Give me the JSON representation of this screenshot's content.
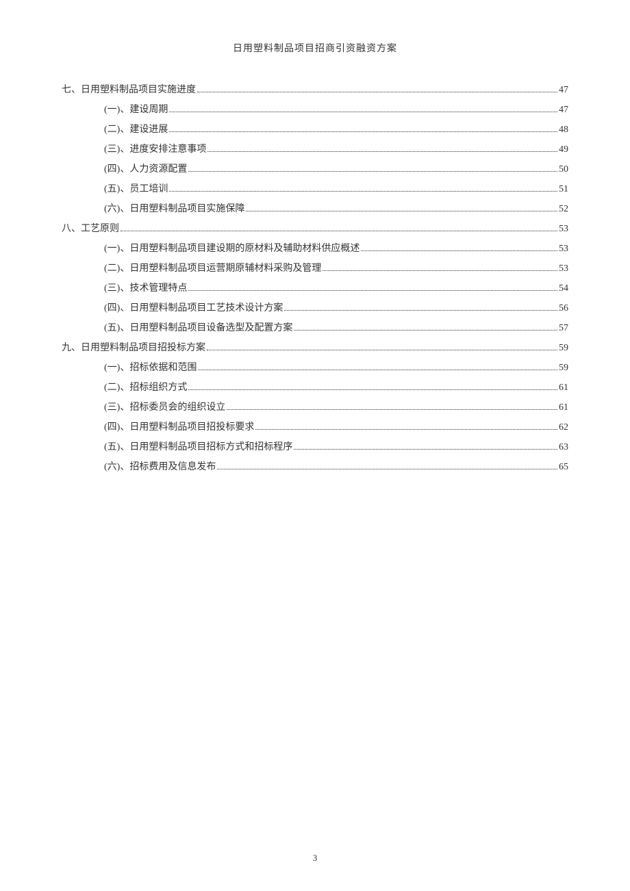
{
  "header": {
    "title": "日用塑料制品项目招商引资融资方案"
  },
  "toc": [
    {
      "level": 1,
      "label": "七、日用塑料制品项目实施进度",
      "page": "47"
    },
    {
      "level": 2,
      "label": "(一)、建设周期",
      "page": "47"
    },
    {
      "level": 2,
      "label": "(二)、建设进展",
      "page": "48"
    },
    {
      "level": 2,
      "label": "(三)、进度安排注意事项",
      "page": "49"
    },
    {
      "level": 2,
      "label": "(四)、人力资源配置",
      "page": "50"
    },
    {
      "level": 2,
      "label": "(五)、员工培训",
      "page": "51"
    },
    {
      "level": 2,
      "label": "(六)、日用塑料制品项目实施保障",
      "page": "52"
    },
    {
      "level": 1,
      "label": "八、工艺原则",
      "page": "53"
    },
    {
      "level": 2,
      "label": "(一)、日用塑料制品项目建设期的原材料及辅助材料供应概述",
      "page": "53"
    },
    {
      "level": 2,
      "label": "(二)、日用塑料制品项目运营期原辅材料采购及管理",
      "page": "53"
    },
    {
      "level": 2,
      "label": "(三)、技术管理特点",
      "page": "54"
    },
    {
      "level": 2,
      "label": "(四)、日用塑料制品项目工艺技术设计方案",
      "page": "56"
    },
    {
      "level": 2,
      "label": "(五)、日用塑料制品项目设备选型及配置方案",
      "page": "57"
    },
    {
      "level": 1,
      "label": "九、日用塑料制品项目招投标方案",
      "page": "59"
    },
    {
      "level": 2,
      "label": "(一)、招标依据和范围",
      "page": "59"
    },
    {
      "level": 2,
      "label": "(二)、招标组织方式",
      "page": "61"
    },
    {
      "level": 2,
      "label": "(三)、招标委员会的组织设立",
      "page": "61"
    },
    {
      "level": 2,
      "label": "(四)、日用塑料制品项目招投标要求",
      "page": "62"
    },
    {
      "level": 2,
      "label": "(五)、日用塑料制品项目招标方式和招标程序",
      "page": "63"
    },
    {
      "level": 2,
      "label": "(六)、招标费用及信息发布",
      "page": "65"
    }
  ],
  "footer": {
    "page_number": "3"
  }
}
